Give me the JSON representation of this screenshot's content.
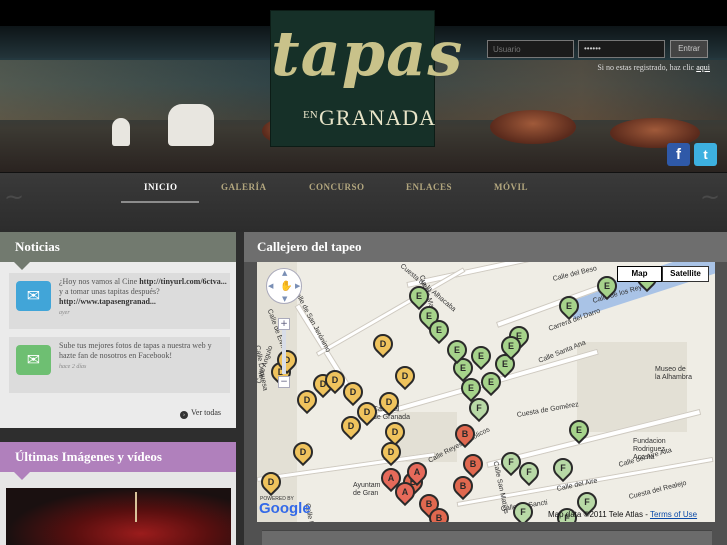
{
  "header": {
    "logo": {
      "main": "tapas",
      "connector": "EN",
      "city": "GRANADA"
    },
    "login": {
      "user_placeholder": "Usuario",
      "password_value": "••••••",
      "submit_label": "Entrar",
      "register_text": "Si no estas registrado, haz clic",
      "register_link": "aqui"
    },
    "social": {
      "facebook": "f",
      "twitter": "t"
    }
  },
  "nav": {
    "items": [
      {
        "label": "INICIO",
        "active": true
      },
      {
        "label": "GALERÍA"
      },
      {
        "label": "CONCURSO"
      },
      {
        "label": "ENLACES"
      },
      {
        "label": "MÓVIL"
      }
    ]
  },
  "news": {
    "title": "Noticias",
    "items": [
      {
        "text": "¿Hoy nos vamos al Cine",
        "link": "http://tinyurl.com/6ctva...",
        "text2": "y a tomar unas tapitas después?",
        "link2": "http://www.tapasengranad...",
        "time": "ayer"
      },
      {
        "text": "Sube tus mejores fotos de tapas a nuestra web y hazte fan de nosotros en Facebook!",
        "time": "hace 2 días"
      }
    ],
    "see_all": "Ver todas"
  },
  "media": {
    "title": "Últimas Imágenes y vídeos"
  },
  "map": {
    "title": "Callejero del tapeo",
    "type_buttons": [
      "Map",
      "Satellite"
    ],
    "zoom_in": "+",
    "zoom_out": "−",
    "streets": [
      "Calle de San Jerónimo",
      "Calle Reyes Católicos",
      "Carrera del Darro",
      "Calle Santa Ana",
      "Cuesta de Gomérez",
      "Cuesta Marañas",
      "Calle del Aire Alta",
      "Cuesta del Realejo",
      "Calle San Matías",
      "Calle Angulo",
      "Calle del Beso",
      "Cuesta de la Alhacaba",
      "Calle de Elvira",
      "Calle Duquesa",
      "Calle Pavaneras",
      "Calle de los Reyes",
      "Calle del Aire",
      "Calle de Sancti"
    ],
    "pois": [
      {
        "lines": [
          "Museo de",
          "la Alhambra"
        ]
      },
      {
        "lines": [
          "Fundacion",
          "Rodriguez",
          "Acosta"
        ]
      },
      {
        "lines": [
          "Catedral",
          "de Granada"
        ]
      },
      {
        "lines": [
          "Ayuntam",
          "de Gran"
        ]
      }
    ],
    "pins": [
      {
        "letter": "E"
      },
      {
        "letter": "E"
      },
      {
        "letter": "E"
      },
      {
        "letter": "E"
      },
      {
        "letter": "E"
      },
      {
        "letter": "E"
      },
      {
        "letter": "E"
      },
      {
        "letter": "E"
      },
      {
        "letter": "E"
      },
      {
        "letter": "E"
      },
      {
        "letter": "E"
      },
      {
        "letter": "E"
      },
      {
        "letter": "E"
      },
      {
        "letter": "E"
      },
      {
        "letter": "E"
      },
      {
        "letter": "D"
      },
      {
        "letter": "D"
      },
      {
        "letter": "D"
      },
      {
        "letter": "D"
      },
      {
        "letter": "D"
      },
      {
        "letter": "D"
      },
      {
        "letter": "D"
      },
      {
        "letter": "D"
      },
      {
        "letter": "D"
      },
      {
        "letter": "D"
      },
      {
        "letter": "D"
      },
      {
        "letter": "D"
      },
      {
        "letter": "D"
      },
      {
        "letter": "D"
      },
      {
        "letter": "D"
      },
      {
        "letter": "F"
      },
      {
        "letter": "F"
      },
      {
        "letter": "F"
      },
      {
        "letter": "F"
      },
      {
        "letter": "F"
      },
      {
        "letter": "F"
      },
      {
        "letter": "F"
      },
      {
        "letter": "B"
      },
      {
        "letter": "B"
      },
      {
        "letter": "B"
      },
      {
        "letter": "B"
      },
      {
        "letter": "B"
      },
      {
        "letter": "B"
      },
      {
        "letter": "A"
      },
      {
        "letter": "A"
      },
      {
        "letter": "A"
      }
    ],
    "powered_by": "POWERED BY",
    "google": "Google",
    "attribution": "Map data ©2011 Tele Atlas -",
    "terms": "Terms of Use"
  },
  "colors": {
    "nav_active": "#ffffff",
    "nav_inactive": "#b2a67e",
    "news_header": "#727a6f",
    "media_header": "#b080bc",
    "pin_d": "#efc35d",
    "pin_e": "#a6d38b",
    "pin_b": "#e0684f"
  }
}
